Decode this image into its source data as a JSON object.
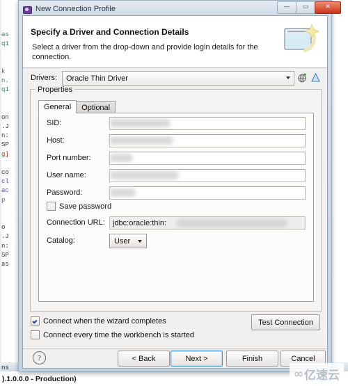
{
  "window": {
    "title": "New Connection Profile",
    "icon": "profile-icon",
    "controls": {
      "minimize": "—",
      "maximize": "▭",
      "close": "✕"
    }
  },
  "banner": {
    "title": "Specify a Driver and Connection Details",
    "description": "Select a driver from the drop-down and provide login details for the connection.",
    "icon": "wizard-banner-icon"
  },
  "drivers": {
    "label": "Drivers:",
    "selected": "Oracle Thin Driver",
    "options": [
      "Oracle Thin Driver"
    ],
    "new_driver_icon": "new-driver-icon",
    "edit_driver_icon": "edit-driver-icon"
  },
  "properties": {
    "legend": "Properties",
    "tabs": [
      {
        "label": "General",
        "active": true
      },
      {
        "label": "Optional",
        "active": false
      }
    ],
    "fields": [
      {
        "label": "SID:",
        "value": "",
        "redacted": true,
        "redact_width": 88
      },
      {
        "label": "Host:",
        "value": "",
        "redacted": true,
        "redact_width": 92
      },
      {
        "label": "Port number:",
        "value": "",
        "redacted": true,
        "redact_width": 34
      },
      {
        "label": "User name:",
        "value": "",
        "redacted": true,
        "redact_width": 100
      },
      {
        "label": "Password:",
        "value": "",
        "redacted": true,
        "redact_width": 38
      }
    ],
    "save_password": {
      "label": "Save password",
      "checked": false
    },
    "connection_url": {
      "label": "Connection URL:",
      "value": "jdbc:oracle:thin:"
    },
    "catalog": {
      "label": "Catalog:",
      "selected": "User",
      "options": [
        "User"
      ]
    }
  },
  "options": {
    "connect_on_complete": {
      "label": "Connect when the wizard completes",
      "checked": true
    },
    "connect_on_startup": {
      "label": "Connect every time the workbench is started",
      "checked": false
    },
    "test_connection": "Test Connection"
  },
  "buttonbar": {
    "help": "?",
    "back": "< Back",
    "next": "Next >",
    "finish": "Finish",
    "cancel": "Cancel"
  },
  "background": {
    "code_lines": [
      "as",
      "q1",
      "",
      "",
      "k",
      "n.",
      "q1",
      "",
      "",
      "on",
      ".J",
      "n:",
      "SP",
      "g]",
      "",
      "co",
      "cl",
      "ac",
      "p",
      "",
      "",
      "o",
      ".J",
      "n:",
      "SP",
      "as"
    ],
    "ns_text": "ns",
    "status_text": ").1.0.0.0 - Production)"
  },
  "watermark": {
    "cloud": "∞",
    "text": "亿速云"
  }
}
